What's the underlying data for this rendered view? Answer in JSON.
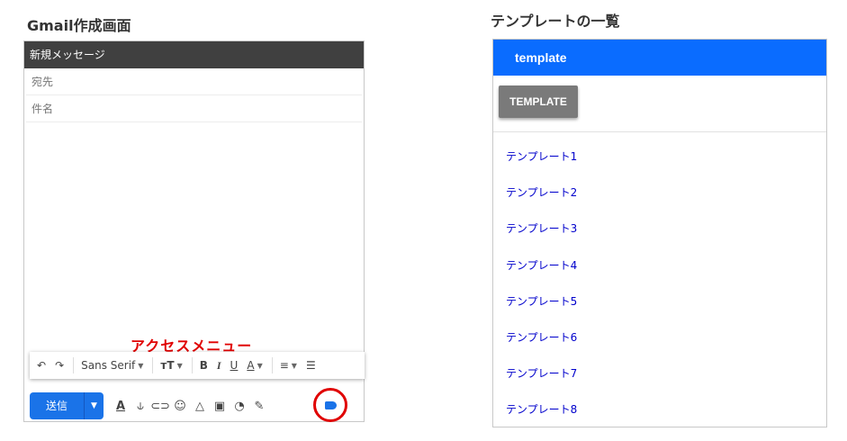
{
  "captions": {
    "left": "Gmail作成画面",
    "right": "テンプレートの一覧"
  },
  "compose": {
    "title": "新規メッセージ",
    "to_label": "宛先",
    "subject_label": "件名",
    "access_menu_label": "アクセスメニュー",
    "toolbar": {
      "undo_icon": "↶",
      "redo_icon": "↷",
      "font_name": "Sans Serif",
      "font_size_icon": "тT",
      "bold": "B",
      "italic": "I",
      "underline": "U",
      "text_color": "A",
      "align_icon": "≡",
      "list_icon": "☰"
    },
    "send_label": "送信",
    "send_more_icon": "▼",
    "bottom_icons": {
      "format": "A",
      "attach": "⫝",
      "link": "⊂⊃",
      "emoji": "☺",
      "drive": "△",
      "photo": "▣",
      "confidential": "◔",
      "signature": "✎"
    },
    "accent_color": "#1a73e8",
    "highlight_color": "#e00000"
  },
  "template_panel": {
    "header": "template",
    "button_label": "TEMPLATE",
    "items": [
      "テンプレート1",
      "テンプレート2",
      "テンプレート3",
      "テンプレート4",
      "テンプレート5",
      "テンプレート6",
      "テンプレート7",
      "テンプレート8"
    ],
    "header_color": "#0a6cff"
  }
}
